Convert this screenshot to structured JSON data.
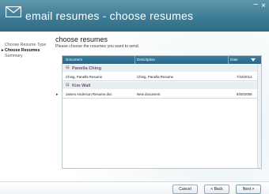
{
  "window": {
    "title": "email resumes - choose resumes",
    "minimize_glyph": "–",
    "close_glyph": "×"
  },
  "nav": {
    "items": [
      {
        "label": "Choose Resume Type",
        "active": false
      },
      {
        "label": "Choose Resumes",
        "active": true
      },
      {
        "label": "Summary",
        "active": false
      }
    ],
    "active_marker": "▸"
  },
  "main": {
    "heading": "choose resumes",
    "instructions": "Please choose the resumes you want to send."
  },
  "grid": {
    "columns": [
      "Document",
      "Description",
      "Date"
    ],
    "groups": [
      {
        "name": "Panella Ching",
        "rows": [
          {
            "document": "Ching, Panella Resume",
            "description": "Ching, Panella Resume",
            "date": "7/19/2012",
            "marker": ""
          }
        ]
      },
      {
        "name": "Kim Wall",
        "rows": [
          {
            "document": "James Anderson Resume.doc",
            "description": "New document",
            "date": "9/20/2006",
            "marker": "▸"
          }
        ]
      }
    ],
    "collapse_glyph": "⊟"
  },
  "footer": {
    "cancel_label": "Cancel",
    "back_label": "< Back",
    "next_label": "Next >"
  },
  "colors": {
    "titlebar": "#3f7d97",
    "grid_header": "#2a6687",
    "group_text": "#7a4f7a"
  },
  "icons": {
    "app_icon": "envelope-icon",
    "sort": "sort-desc-icon"
  }
}
